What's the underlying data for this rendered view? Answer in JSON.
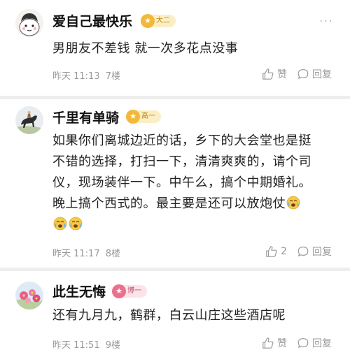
{
  "comments": [
    {
      "username": "爱自己最快乐",
      "badge": {
        "icon": "star-icon",
        "label": "大二",
        "color": "#f3b83b"
      },
      "text_lines": [
        "男朋友不差钱  就一次多花点没事"
      ],
      "time": "昨天 11:13",
      "floor": "7楼",
      "like_label": "赞",
      "reply_label": "回复"
    },
    {
      "username": "千里有单骑",
      "badge": {
        "icon": "star-icon",
        "label": "高一",
        "color": "#f3b83b"
      },
      "text_lines": [
        "如果你们离城边近的话，乡下的大会堂也是挺",
        "不错的选择，打扫一下，清清爽爽的，请个司",
        "仪，现场装伴一下。中午么，搞个中期婚礼。",
        "晚上搞个西式的。最主要是还可以放炮仗"
      ],
      "time": "昨天 11:17",
      "floor": "8楼",
      "like_count": "2",
      "reply_label": "回复"
    },
    {
      "username": "此生无悔",
      "badge": {
        "icon": "star-icon",
        "label": "博一",
        "color": "#ec6f8e"
      },
      "text_lines": [
        "还有九月九，鹤群，白云山庄这些酒店呢"
      ],
      "time": "昨天 11:51",
      "floor": "9楼",
      "like_label": "赞",
      "reply_label": "回复"
    }
  ],
  "more_symbol": "···"
}
